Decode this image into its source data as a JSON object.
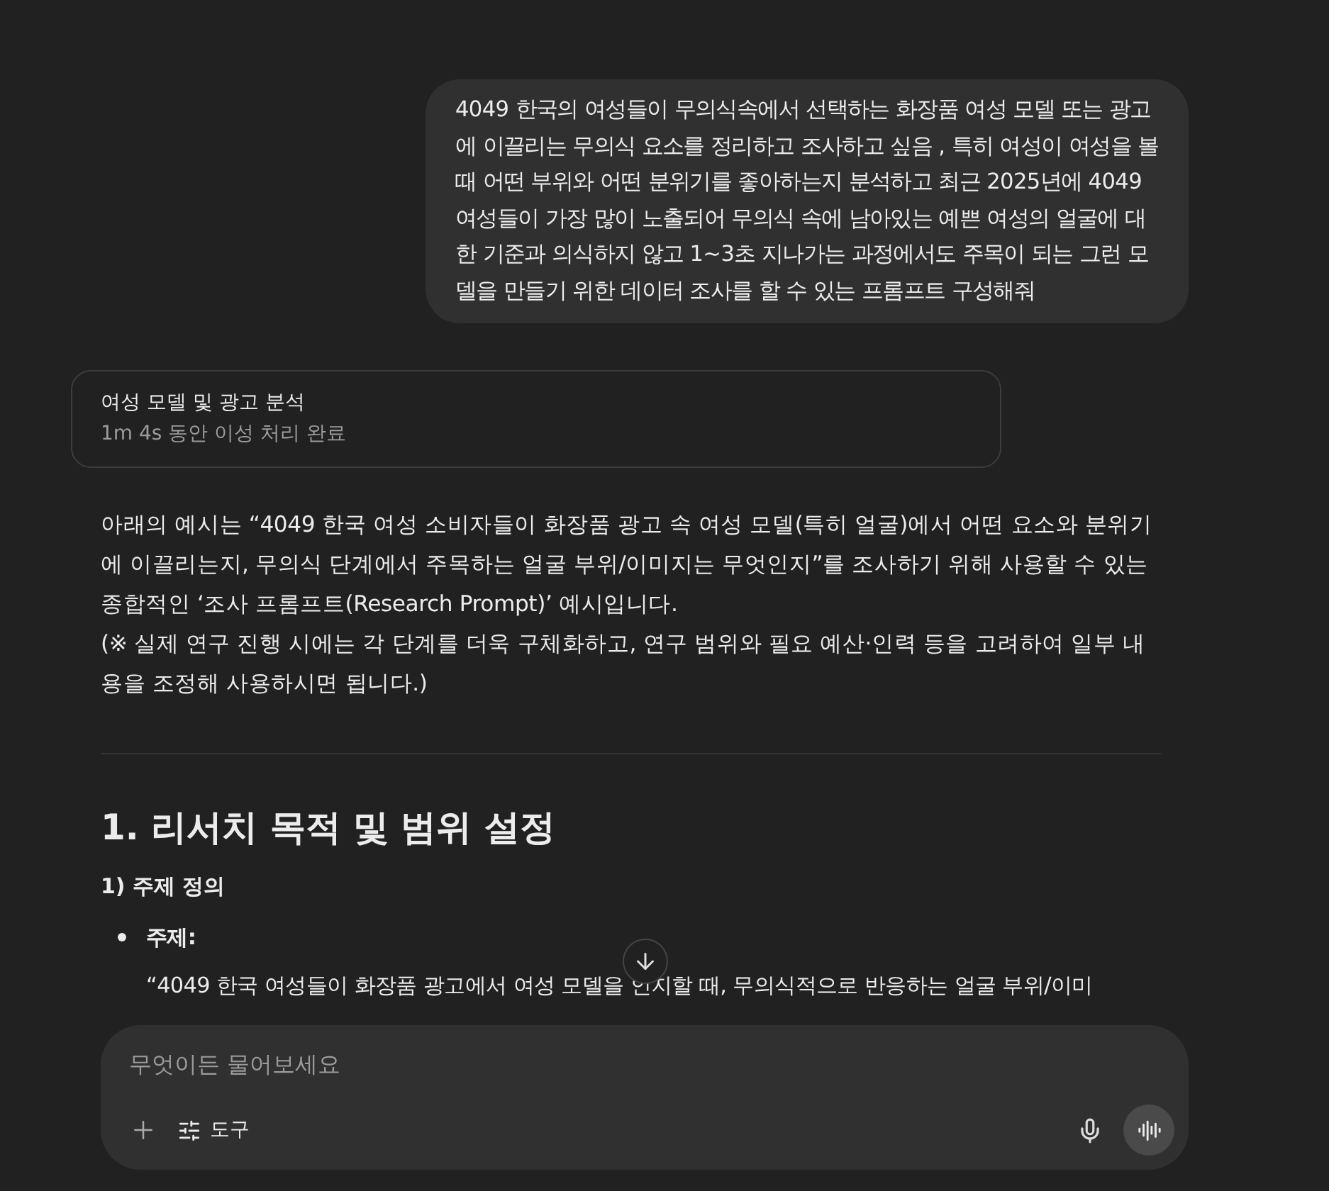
{
  "user_message": "4049 한국의 여성들이 무의식속에서 선택하는 화장품 여성 모델 또는 광고에 이끌리는 무의식 요소를 정리하고 조사하고 싶음 , 특히 여성이 여성을 볼 때 어떤 부위와 어떤 분위기를 좋아하는지 분석하고 최근 2025년에 4049 여성들이 가장 많이 노출되어 무의식 속에 남아있는 예쁜 여성의 얼굴에 대한 기준과 의식하지 않고 1~3초 지나가는 과정에서도 주목이 되는 그런 모델을 만들기 위한 데이터 조사를 할 수 있는 프롬프트 구성해줘",
  "reasoning": {
    "title": "여성 모델 및 광고 분석",
    "status": "1m 4s 동안 이성 처리 완료"
  },
  "answer": {
    "paragraphs": [
      "아래의 예시는 “4049 한국 여성 소비자들이 화장품 광고 속 여성 모델(특히 얼굴)에서 어떤 요소와 분위기에 이끌리는지, 무의식 단계에서 주목하는 얼굴 부위/이미지는 무엇인지”를 조사하기 위해 사용할 수 있는 종합적인 ‘조사 프롬프트(Research Prompt)’ 예시입니다.",
      "(※ 실제 연구 진행 시에는 각 단계를 더욱 구체화하고, 연구 범위와 필요 예산·인력 등을 고려하여 일부 내용을 조정해 사용하시면 됩니다.)"
    ],
    "heading": "1. 리서치 목적 및 범위 설정",
    "subheading": "1) 주제 정의",
    "bullets": [
      {
        "label": "주제:",
        "text": "“4049 한국 여성들이 화장품 광고에서 여성 모델을 인지할 때, 무의식적으로 반응하는 얼굴 부위/이미"
      }
    ]
  },
  "composer": {
    "placeholder": "무엇이든 물어보세요",
    "tools_label": "도구"
  }
}
